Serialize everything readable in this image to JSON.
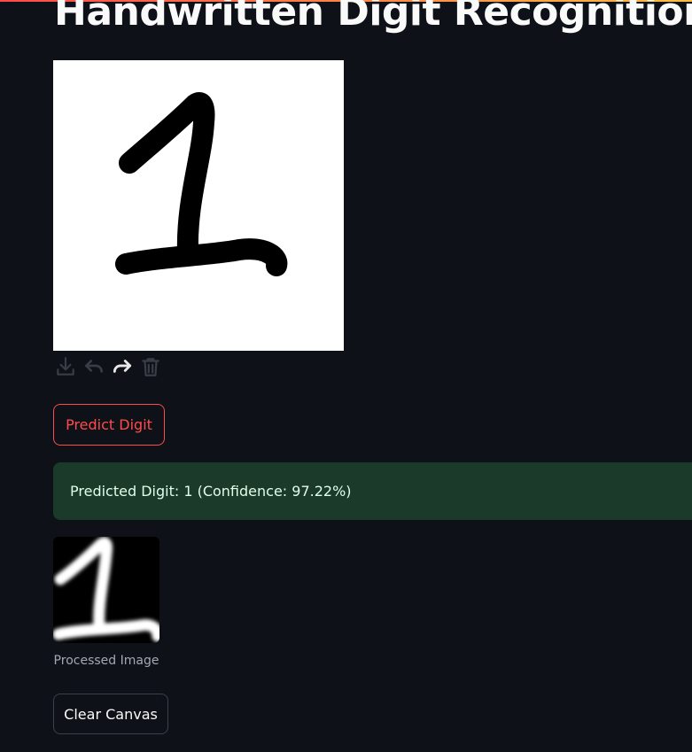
{
  "page": {
    "title": "Handwritten Digit Recognition"
  },
  "canvas": {
    "toolbar": [
      "download-icon",
      "undo-icon",
      "redo-icon",
      "trash-icon"
    ]
  },
  "actions": {
    "predict_label": "Predict Digit",
    "clear_label": "Clear Canvas"
  },
  "result": {
    "message": "Predicted Digit: 1 (Confidence: 97.22%)",
    "status_color": "#1b3a2a"
  },
  "processed": {
    "caption": "Processed Image"
  },
  "colors": {
    "background": "#0e1117",
    "accent": "#ff4b4b",
    "text": "#fafafa"
  }
}
